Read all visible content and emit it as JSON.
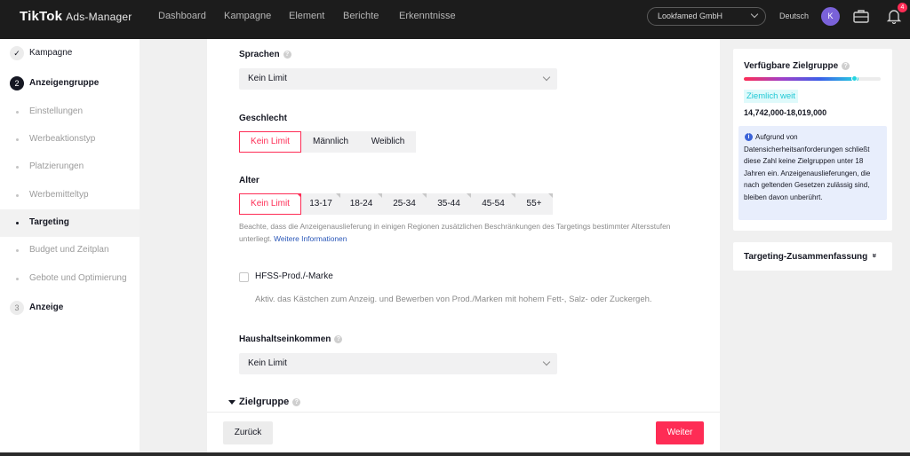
{
  "header": {
    "logo": "TikTok",
    "logo_sub": "Ads-Manager",
    "nav": [
      "Dashboard",
      "Kampagne",
      "Element",
      "Berichte",
      "Erkenntnisse"
    ],
    "account": "Lookfamed GmbH",
    "language": "Deutsch",
    "avatar_letter": "K",
    "notification_count": "4",
    "accent_color": "#fe2c55"
  },
  "sidebar": {
    "steps": [
      {
        "number": "✓",
        "label": "Kampagne"
      },
      {
        "number": "2",
        "label": "Anzeigengruppe"
      },
      {
        "number": "3",
        "label": "Anzeige"
      }
    ],
    "sub_items": [
      "Einstellungen",
      "Werbeaktionstyp",
      "Platzierungen",
      "Werbemitteltyp",
      "Targeting",
      "Budget und Zeitplan",
      "Gebote und Optimierung"
    ],
    "active_sub_item": "Targeting"
  },
  "form": {
    "languages_label": "Sprachen",
    "languages_value": "Kein Limit",
    "gender_label": "Geschlecht",
    "gender_options": [
      "Kein Limit",
      "Männlich",
      "Weiblich"
    ],
    "age_label": "Alter",
    "age_options": [
      "Kein Limit",
      "13-17",
      "18-24",
      "25-34",
      "35-44",
      "45-54",
      "55+"
    ],
    "age_note": "Beachte, dass die Anzeigenauslieferung in einigen Regionen zusätzlichen Beschränkungen des Targetings bestimmter Altersstufen unterliegt.",
    "age_note_link": "Weitere Informationen",
    "hfss_label": "HFSS-Prod./-Marke",
    "hfss_desc": "Aktiv. das Kästchen zum Anzeig. und Bewerben von Prod./Marken mit hohem Fett-, Salz- oder Zuckergeh.",
    "income_label": "Haushaltseinkommen",
    "income_value": "Kein Limit",
    "audience_label": "Zielgruppe"
  },
  "footer": {
    "back": "Zurück",
    "next": "Weiter"
  },
  "audience_panel": {
    "title": "Verfügbare Zielgruppe",
    "range_tag": "Ziemlich weit",
    "range": "14,742,000-18,019,000",
    "gauge_level": 0.84,
    "info_text": "Aufgrund von Datensicherheitsanforderungen schließt diese Zahl keine Zielgruppen unter 18 Jahren ein. Anzeigenauslieferungen, die nach geltenden Gesetzen zulässig sind, bleiben davon unberührt."
  },
  "summary_panel": {
    "title": "Targeting-Zusammenfassung"
  }
}
